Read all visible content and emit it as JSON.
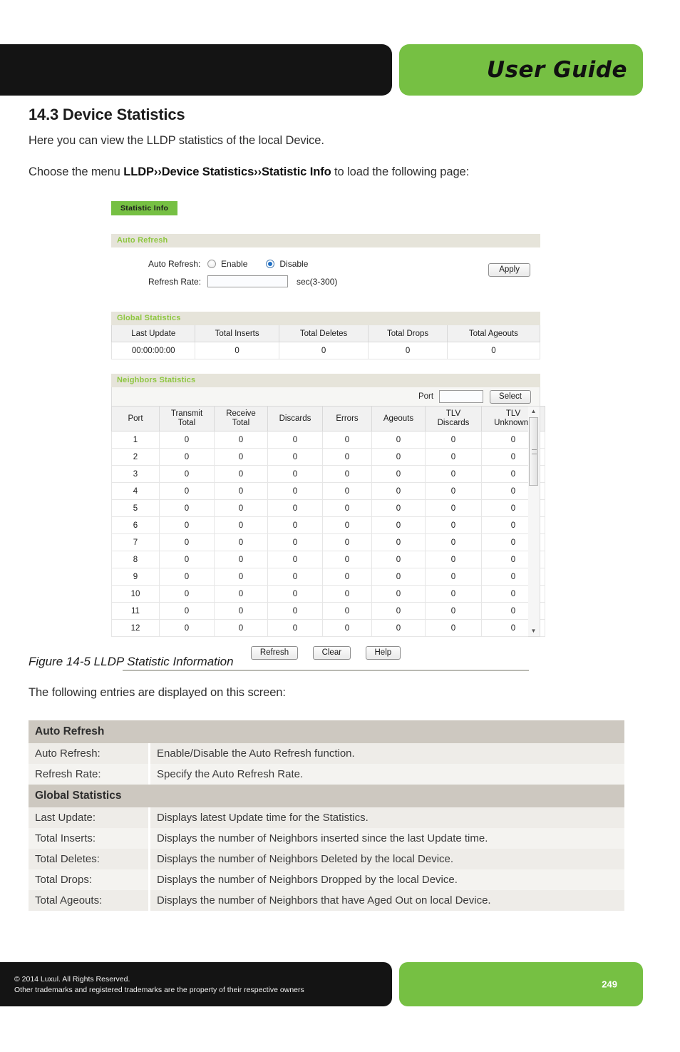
{
  "header": {
    "title": "User Guide"
  },
  "doc": {
    "section_number_title": "14.3 Device Statistics",
    "intro": "Here you can view the LLDP statistics of the local Device.",
    "choose_prefix": "Choose the menu ",
    "choose_menu_path": "LLDP››Device Statistics››Statistic Info",
    "choose_suffix": " to load the following page:",
    "figure_caption": "Figure 14-5 LLDP Statistic Information",
    "entries_intro": "The following entries are displayed on this screen:"
  },
  "ui": {
    "tab_label": "Statistic Info",
    "auto_refresh": {
      "section_title": "Auto Refresh",
      "auto_refresh_label": "Auto Refresh:",
      "enable_label": "Enable",
      "disable_label": "Disable",
      "selected": "Disable",
      "refresh_rate_label": "Refresh Rate:",
      "refresh_rate_value": "",
      "refresh_rate_placeholder": "",
      "unit_hint": "sec(3-300)",
      "apply_label": "Apply"
    },
    "global_statistics": {
      "section_title": "Global Statistics",
      "columns": [
        "Last Update",
        "Total Inserts",
        "Total Deletes",
        "Total Drops",
        "Total Ageouts"
      ],
      "row": [
        "00:00:00:00",
        "0",
        "0",
        "0",
        "0"
      ]
    },
    "neighbors_statistics": {
      "section_title": "Neighbors Statistics",
      "port_label": "Port",
      "port_value": "",
      "select_label": "Select",
      "columns": [
        "Port",
        "Transmit\nTotal",
        "Receive\nTotal",
        "Discards",
        "Errors",
        "Ageouts",
        "TLV\nDiscards",
        "TLV\nUnknowns"
      ],
      "rows": [
        [
          "1",
          "0",
          "0",
          "0",
          "0",
          "0",
          "0",
          "0"
        ],
        [
          "2",
          "0",
          "0",
          "0",
          "0",
          "0",
          "0",
          "0"
        ],
        [
          "3",
          "0",
          "0",
          "0",
          "0",
          "0",
          "0",
          "0"
        ],
        [
          "4",
          "0",
          "0",
          "0",
          "0",
          "0",
          "0",
          "0"
        ],
        [
          "5",
          "0",
          "0",
          "0",
          "0",
          "0",
          "0",
          "0"
        ],
        [
          "6",
          "0",
          "0",
          "0",
          "0",
          "0",
          "0",
          "0"
        ],
        [
          "7",
          "0",
          "0",
          "0",
          "0",
          "0",
          "0",
          "0"
        ],
        [
          "8",
          "0",
          "0",
          "0",
          "0",
          "0",
          "0",
          "0"
        ],
        [
          "9",
          "0",
          "0",
          "0",
          "0",
          "0",
          "0",
          "0"
        ],
        [
          "10",
          "0",
          "0",
          "0",
          "0",
          "0",
          "0",
          "0"
        ],
        [
          "11",
          "0",
          "0",
          "0",
          "0",
          "0",
          "0",
          "0"
        ],
        [
          "12",
          "0",
          "0",
          "0",
          "0",
          "0",
          "0",
          "0"
        ]
      ]
    },
    "buttons": {
      "refresh": "Refresh",
      "clear": "Clear",
      "help": "Help"
    }
  },
  "description_table": [
    {
      "type": "group",
      "label": "Auto Refresh"
    },
    {
      "type": "row",
      "key": "Auto Refresh:",
      "desc": "Enable/Disable the Auto Refresh function."
    },
    {
      "type": "row",
      "key": "Refresh Rate:",
      "desc": "Specify the Auto Refresh Rate."
    },
    {
      "type": "group",
      "label": "Global Statistics"
    },
    {
      "type": "row",
      "key": "Last Update:",
      "desc": "Displays latest Update time for the Statistics."
    },
    {
      "type": "row",
      "key": "Total Inserts:",
      "desc": "Displays the number of Neighbors inserted since the last Update time."
    },
    {
      "type": "row",
      "key": "Total Deletes:",
      "desc": "Displays the number of Neighbors Deleted by the local Device."
    },
    {
      "type": "row",
      "key": "Total Drops:",
      "desc": "Displays the number of Neighbors Dropped by the local Device."
    },
    {
      "type": "row",
      "key": "Total Ageouts:",
      "desc": "Displays the number of Neighbors that have Aged Out on local Device."
    }
  ],
  "footer": {
    "copyright_line1": "© 2014  Luxul. All Rights Reserved.",
    "copyright_line2": "Other trademarks and registered trademarks are the property of their respective owners",
    "page_number": "249"
  },
  "colors": {
    "brand_green": "#76c043",
    "black_bar": "#141414",
    "panel_header": "#e6e4da",
    "group_row": "#cdc8c0"
  }
}
